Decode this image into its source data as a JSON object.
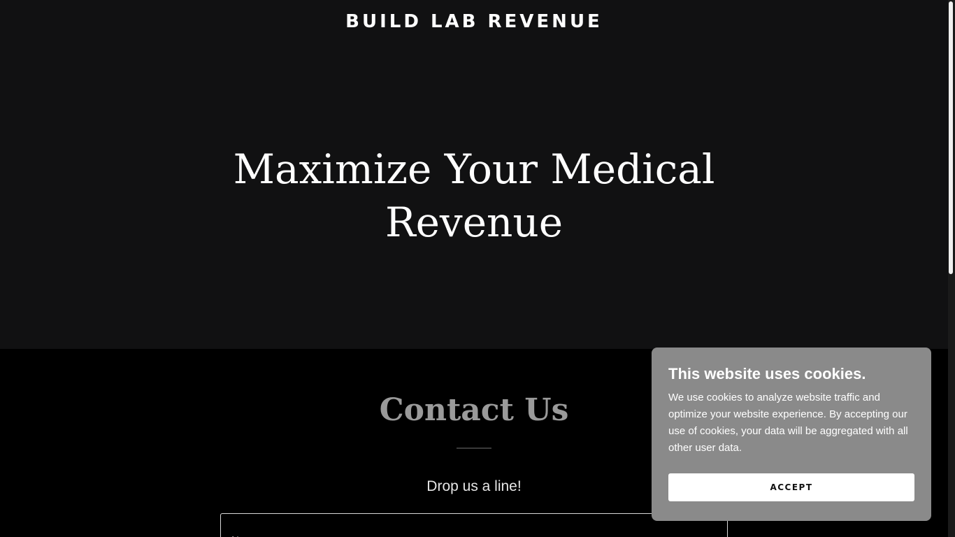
{
  "header": {
    "brand": "BUILD LAB REVENUE"
  },
  "hero": {
    "title": "Maximize Your Medical Revenue"
  },
  "contact": {
    "title": "Contact Us",
    "subtitle": "Drop us a line!",
    "name_placeholder": "Name"
  },
  "cookie_banner": {
    "title": "This website uses cookies.",
    "text": "We use cookies to analyze website traffic and optimize your website experience. By accepting our use of cookies, your data will be aggregated with all other user data.",
    "accept_label": "ACCEPT"
  },
  "colors": {
    "hero_background": "#111112",
    "page_background": "#000000",
    "cookie_background": "#8a8a8a",
    "contact_title": "#9a9a9a"
  }
}
